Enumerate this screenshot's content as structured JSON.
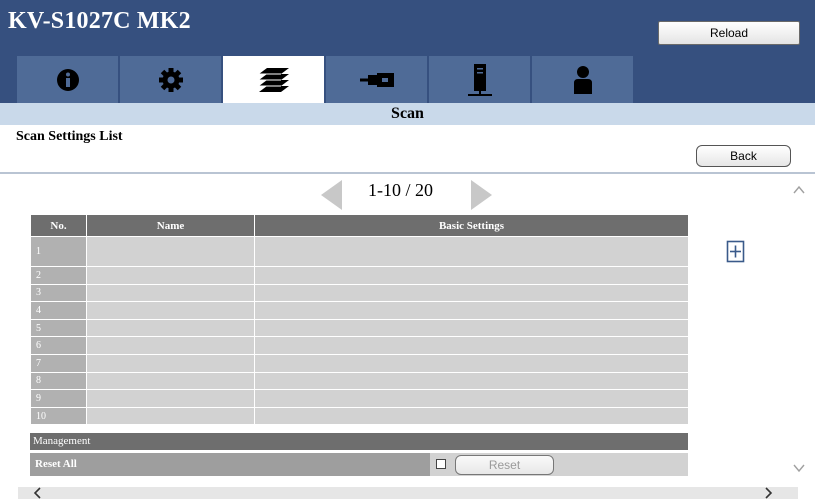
{
  "app": {
    "title": "KV-S1027C MK2",
    "reload_label": "Reload"
  },
  "tabs": [
    {
      "name": "info",
      "icon": "info-circle-icon"
    },
    {
      "name": "settings",
      "icon": "gear-icon"
    },
    {
      "name": "scan",
      "icon": "stacked-documents-icon",
      "active": true
    },
    {
      "name": "network",
      "icon": "cable-connector-icon"
    },
    {
      "name": "device",
      "icon": "scanner-device-icon"
    },
    {
      "name": "user",
      "icon": "user-icon"
    }
  ],
  "section": {
    "title": "Scan"
  },
  "list": {
    "title": "Scan Settings List",
    "back_label": "Back"
  },
  "pager": {
    "text": "1-10 / 20"
  },
  "table": {
    "headers": {
      "no": "No.",
      "name": "Name",
      "basic": "Basic Settings"
    },
    "rows": [
      {
        "no": "1",
        "name": "",
        "basic": ""
      },
      {
        "no": "2",
        "name": "",
        "basic": ""
      },
      {
        "no": "3",
        "name": "",
        "basic": ""
      },
      {
        "no": "4",
        "name": "",
        "basic": ""
      },
      {
        "no": "5",
        "name": "",
        "basic": ""
      },
      {
        "no": "6",
        "name": "",
        "basic": ""
      },
      {
        "no": "7",
        "name": "",
        "basic": ""
      },
      {
        "no": "8",
        "name": "",
        "basic": ""
      },
      {
        "no": "9",
        "name": "",
        "basic": ""
      },
      {
        "no": "10",
        "name": "",
        "basic": ""
      }
    ]
  },
  "management": {
    "header": "Management",
    "reset_all_label": "Reset All",
    "reset_label": "Reset",
    "checked": false
  },
  "colors": {
    "header_bg": "#36507f",
    "tab_bg": "#4f6b97",
    "section_bg": "#c9d9ea",
    "table_header": "#6e6e6e",
    "table_cell": "#d2d2d2",
    "arrow": "#c8c8c8"
  }
}
